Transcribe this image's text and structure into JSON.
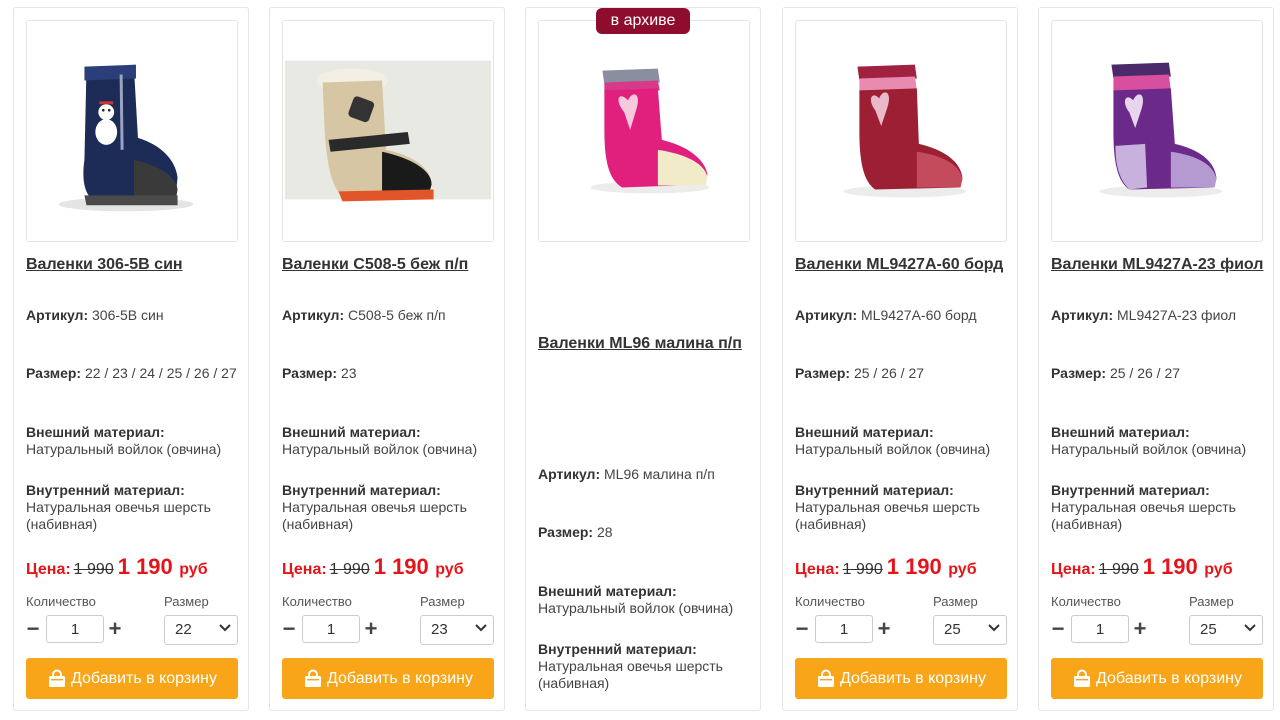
{
  "labels": {
    "article": "Артикул:",
    "size": "Размер:",
    "outer": "Внешний материал:",
    "inner": "Внутренний материал:",
    "price": "Цена:",
    "currency": "руб",
    "quantity": "Количество",
    "size_select": "Размер",
    "cart_button": "Добавить в корзину"
  },
  "colors": {
    "price_red": "#e3151a",
    "cart_orange": "#f9a51a",
    "badge_maroon": "#8e0d2e"
  },
  "products": [
    {
      "name": "Валенки 306-5В син",
      "article": "306-5В син",
      "sizes": "22 / 23 / 24 / 25 / 26 / 27",
      "outer": "Натуральный войлок (овчина)",
      "inner": "Натуральная овечья шерсть (набивная)",
      "old_price": "1 990",
      "new_price": "1 190",
      "quantity": "1",
      "selected_size": "22",
      "image": "blue-felt-boot-snowman"
    },
    {
      "name": "Валенки С508-5 беж п/п",
      "article": "С508-5 беж п/п",
      "sizes": "23",
      "outer": "Натуральный войлок (овчина)",
      "inner": "Натуральная овечья шерсть (набивная)",
      "old_price": "1 990",
      "new_price": "1 190",
      "quantity": "1",
      "selected_size": "23",
      "image": "beige-felt-boot-fur"
    },
    {
      "name": "Валенки ML96 малина п/п",
      "article": "ML96 малина п/п",
      "sizes": "28",
      "outer": "Натуральный войлок (овчина)",
      "inner": "Натуральная овечья шерсть (набивная)",
      "badge": "в архиве",
      "image": "raspberry-felt-boot"
    },
    {
      "name": "Валенки ML9427A-60 борд",
      "article": "ML9427A-60 борд",
      "sizes": "25 / 26 / 27",
      "outer": "Натуральный войлок (овчина)",
      "inner": "Натуральная овечья шерсть (набивная)",
      "old_price": "1 990",
      "new_price": "1 190",
      "quantity": "1",
      "selected_size": "25",
      "image": "burgundy-felt-boot"
    },
    {
      "name": "Валенки ML9427A-23 фиол",
      "article": "ML9427A-23 фиол",
      "sizes": "25 / 26 / 27",
      "outer": "Натуральный войлок (овчина)",
      "inner": "Натуральная овечья шерсть (набивная)",
      "old_price": "1 990",
      "new_price": "1 190",
      "quantity": "1",
      "selected_size": "25",
      "image": "purple-felt-boot"
    }
  ]
}
